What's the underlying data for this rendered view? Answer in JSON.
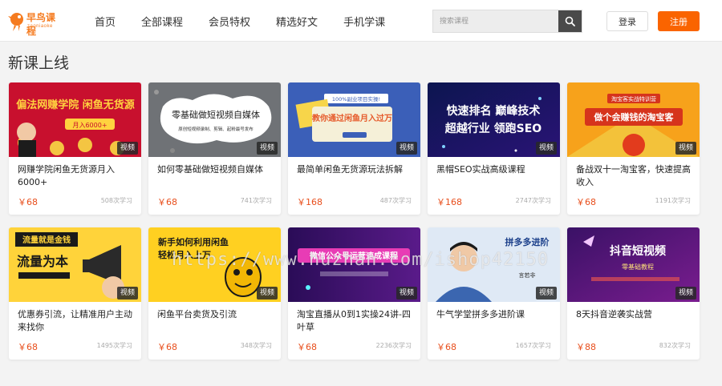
{
  "header": {
    "logo_text": "早鸟课程",
    "logo_sub": "zaoniaoke",
    "nav": [
      "首页",
      "全部课程",
      "会员特权",
      "精选好文",
      "手机学课"
    ],
    "search_placeholder": "搜索课程",
    "login_label": "登录",
    "register_label": "注册"
  },
  "section": {
    "title": "新课上线"
  },
  "courses": [
    {
      "title": "网赚学院闲鱼无货源月入6000+",
      "price": "￥68",
      "learners": "508次学习",
      "tag": "视频",
      "thumb_text": "偏法网赚学院 闲鱼无货源",
      "thumb_sub": "月入6000+"
    },
    {
      "title": "如何零基础做短视频自媒体",
      "price": "￥68",
      "learners": "741次学习",
      "tag": "视频",
      "thumb_text": "零基础做短视频自媒体",
      "thumb_sub": "原创短视频录制、剪辑、起粉最号发布"
    },
    {
      "title": "最简单闲鱼无货源玩法拆解",
      "price": "￥168",
      "learners": "487次学习",
      "tag": "视频",
      "thumb_text": "教你通过闲鱼月入过万",
      "thumb_sub": "100%副业项目实操!"
    },
    {
      "title": "黑帽SEO实战高级课程",
      "price": "￥168",
      "learners": "2747次学习",
      "tag": "视频",
      "thumb_text": "快速排名 巅峰技术",
      "thumb_sub": "超越行业 领跑SEO"
    },
    {
      "title": "备战双十一淘宝客，快速提高收入",
      "price": "￥68",
      "learners": "1191次学习",
      "tag": "视频",
      "thumb_text": "做个会赚钱的淘宝客",
      "thumb_sub": "淘宝客实战特训营"
    },
    {
      "title": "优惠券引流，让精准用户主动来找你",
      "price": "￥68",
      "learners": "1495次学习",
      "tag": "视频",
      "thumb_text": "流量就是金钱",
      "thumb_sub": "流量为本"
    },
    {
      "title": "闲鱼平台卖货及引流",
      "price": "￥68",
      "learners": "348次学习",
      "tag": "视频",
      "thumb_text": "新手如何利用闲鱼",
      "thumb_sub": "轻松月入上万"
    },
    {
      "title": "淘宝直播从0到1实操24讲-四叶草",
      "price": "￥68",
      "learners": "2236次学习",
      "tag": "视频",
      "thumb_text": "微信公众号运营速成课程",
      "thumb_sub": ""
    },
    {
      "title": "牛气学堂拼多多进阶课",
      "price": "￥68",
      "learners": "1657次学习",
      "tag": "视频",
      "thumb_text": "拼多多进阶",
      "thumb_sub": "言若非"
    },
    {
      "title": "8天抖音逆袭实战营",
      "price": "￥88",
      "learners": "832次学习",
      "tag": "视频",
      "thumb_text": "抖音短视频",
      "thumb_sub": "零基础教程"
    }
  ],
  "watermark": "https://www.huzhan.com/ishop42150",
  "colors": {
    "accent": "#fa6400",
    "price": "#e84e1c"
  }
}
